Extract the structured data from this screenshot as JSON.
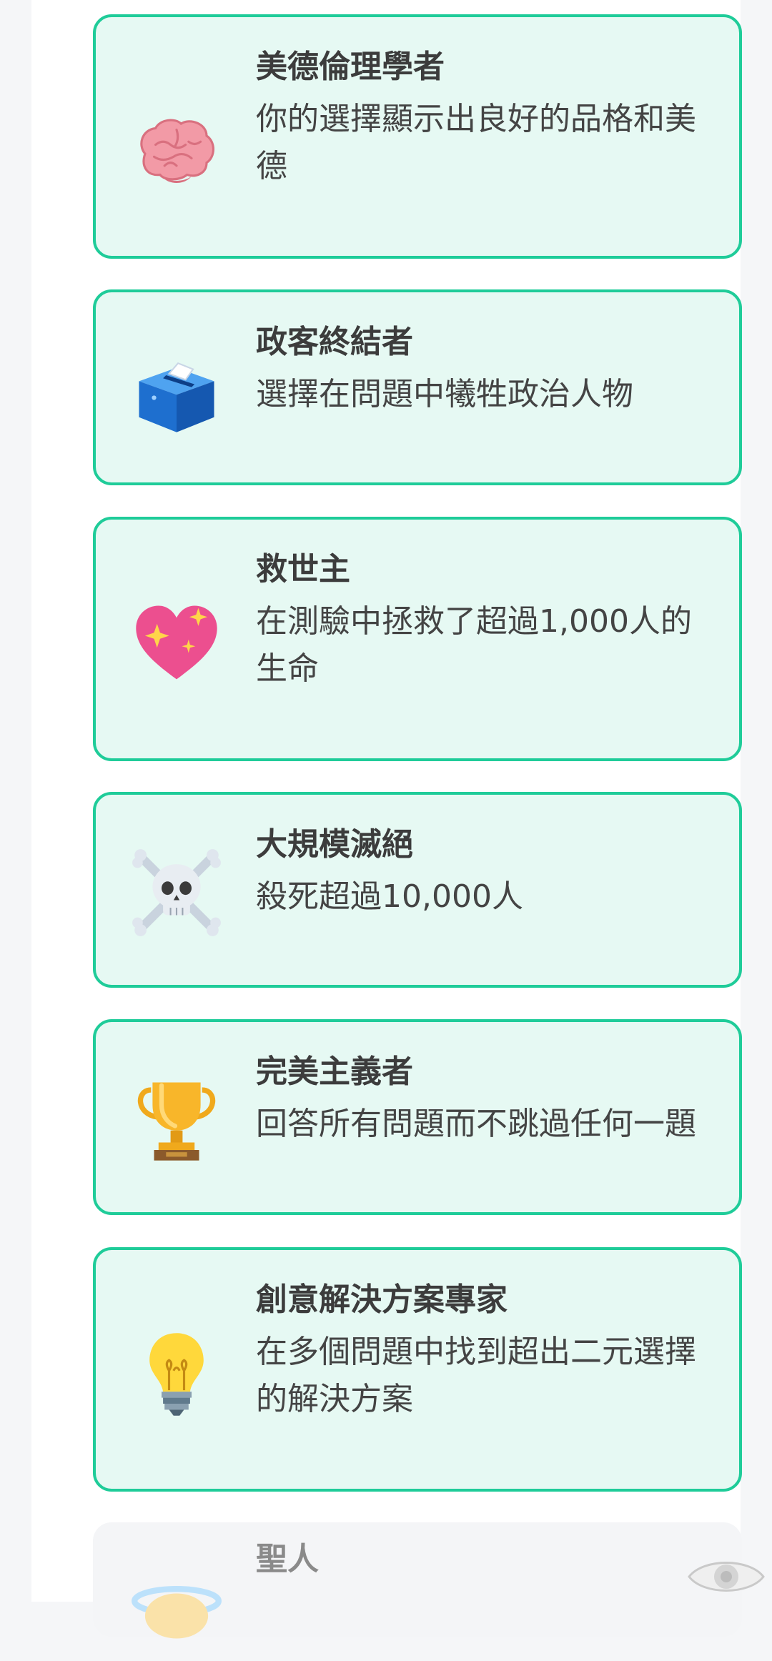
{
  "achievements": [
    {
      "title": "美德倫理學者",
      "description": "你的選擇顯示出良好的品格和美德",
      "icon": "brain-icon",
      "unlocked": true
    },
    {
      "title": "政客終結者",
      "description": "選擇在問題中犧牲政治人物",
      "icon": "ballot-box-icon",
      "unlocked": true
    },
    {
      "title": "救世主",
      "description": "在測驗中拯救了超過1,000人的生命",
      "icon": "sparkling-heart-icon",
      "unlocked": true
    },
    {
      "title": "大規模滅絕",
      "description": "殺死超過10,000人",
      "icon": "skull-crossbones-icon",
      "unlocked": true
    },
    {
      "title": "完美主義者",
      "description": "回答所有問題而不跳過任何一題",
      "icon": "trophy-icon",
      "unlocked": true
    },
    {
      "title": "創意解決方案專家",
      "description": "在多個問題中找到超出二元選擇的解決方案",
      "icon": "light-bulb-icon",
      "unlocked": true
    },
    {
      "title": "聖人",
      "icon": "halo-icon",
      "unlocked": false
    }
  ],
  "colors": {
    "card_border": "#1fcc99",
    "card_fill": "#e6f9f3",
    "locked_fill": "#f4f5f7"
  }
}
